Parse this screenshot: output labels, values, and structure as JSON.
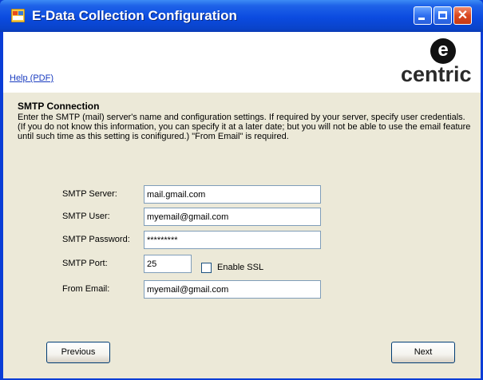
{
  "window": {
    "title": "E-Data Collection Configuration",
    "icons": {
      "app": "app-icon",
      "minimize": "minimize-icon",
      "maximize": "maximize-icon",
      "close": "close-icon"
    }
  },
  "header": {
    "help_link": "Help (PDF)",
    "logo_letter": "e",
    "logo_text": "centric"
  },
  "smtp": {
    "section_title": "SMTP Connection",
    "description": "Enter the SMTP (mail) server's name and configuration settings. If required by your server, specify user credentials. (If you do not know this information, you can specify it at a later date; but you will not be able to use the email feature until such time as this setting is conifigured.)  \"From Email\" is required.",
    "server_label": "SMTP Server:",
    "server_value": "mail.gmail.com",
    "user_label": "SMTP User:",
    "user_value": "myemail@gmail.com",
    "password_label": "SMTP Password:",
    "password_value": "*********",
    "port_label": "SMTP Port:",
    "port_value": "25",
    "ssl_label": "Enable SSL",
    "ssl_checked": false,
    "from_label": "From Email:",
    "from_value": "myemail@gmail.com"
  },
  "buttons": {
    "previous": "Previous",
    "next": "Next"
  },
  "colors": {
    "titlebar": "#0b4be0",
    "content_bg": "#ece9d8",
    "link": "#1a3cc0"
  }
}
